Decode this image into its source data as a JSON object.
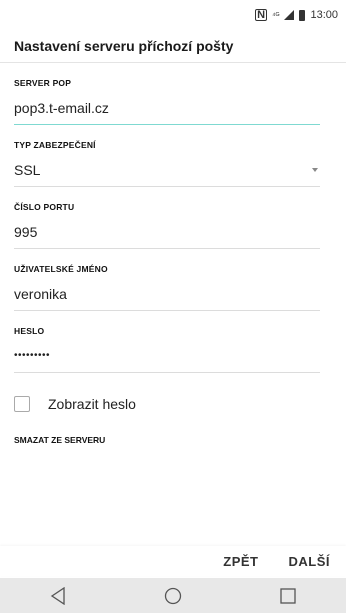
{
  "status_bar": {
    "nfc": "N",
    "time": "13:00"
  },
  "header": {
    "title": "Nastavení serveru příchozí pošty"
  },
  "form": {
    "server_pop": {
      "label": "SERVER POP",
      "value": "pop3.t-email.cz"
    },
    "security_type": {
      "label": "TYP ZABEZPEČENÍ",
      "value": "SSL"
    },
    "port": {
      "label": "ČÍSLO PORTU",
      "value": "995"
    },
    "username": {
      "label": "UŽIVATELSKÉ JMÉNO",
      "value": "veronika"
    },
    "password": {
      "label": "HESLO",
      "value": "•••••••••"
    },
    "show_password": {
      "label": "Zobrazit heslo",
      "checked": false
    },
    "delete_from_server": {
      "label": "SMAZAT ZE SERVERU"
    }
  },
  "actions": {
    "back": "ZPĚT",
    "next": "DALŠÍ"
  },
  "navigation": {
    "back_icon": "back-triangle-icon",
    "home_icon": "home-circle-icon",
    "recents_icon": "recents-square-icon"
  },
  "colors": {
    "active_underline": "#7fd9d1",
    "nav_bar": "#e8e8e8"
  }
}
